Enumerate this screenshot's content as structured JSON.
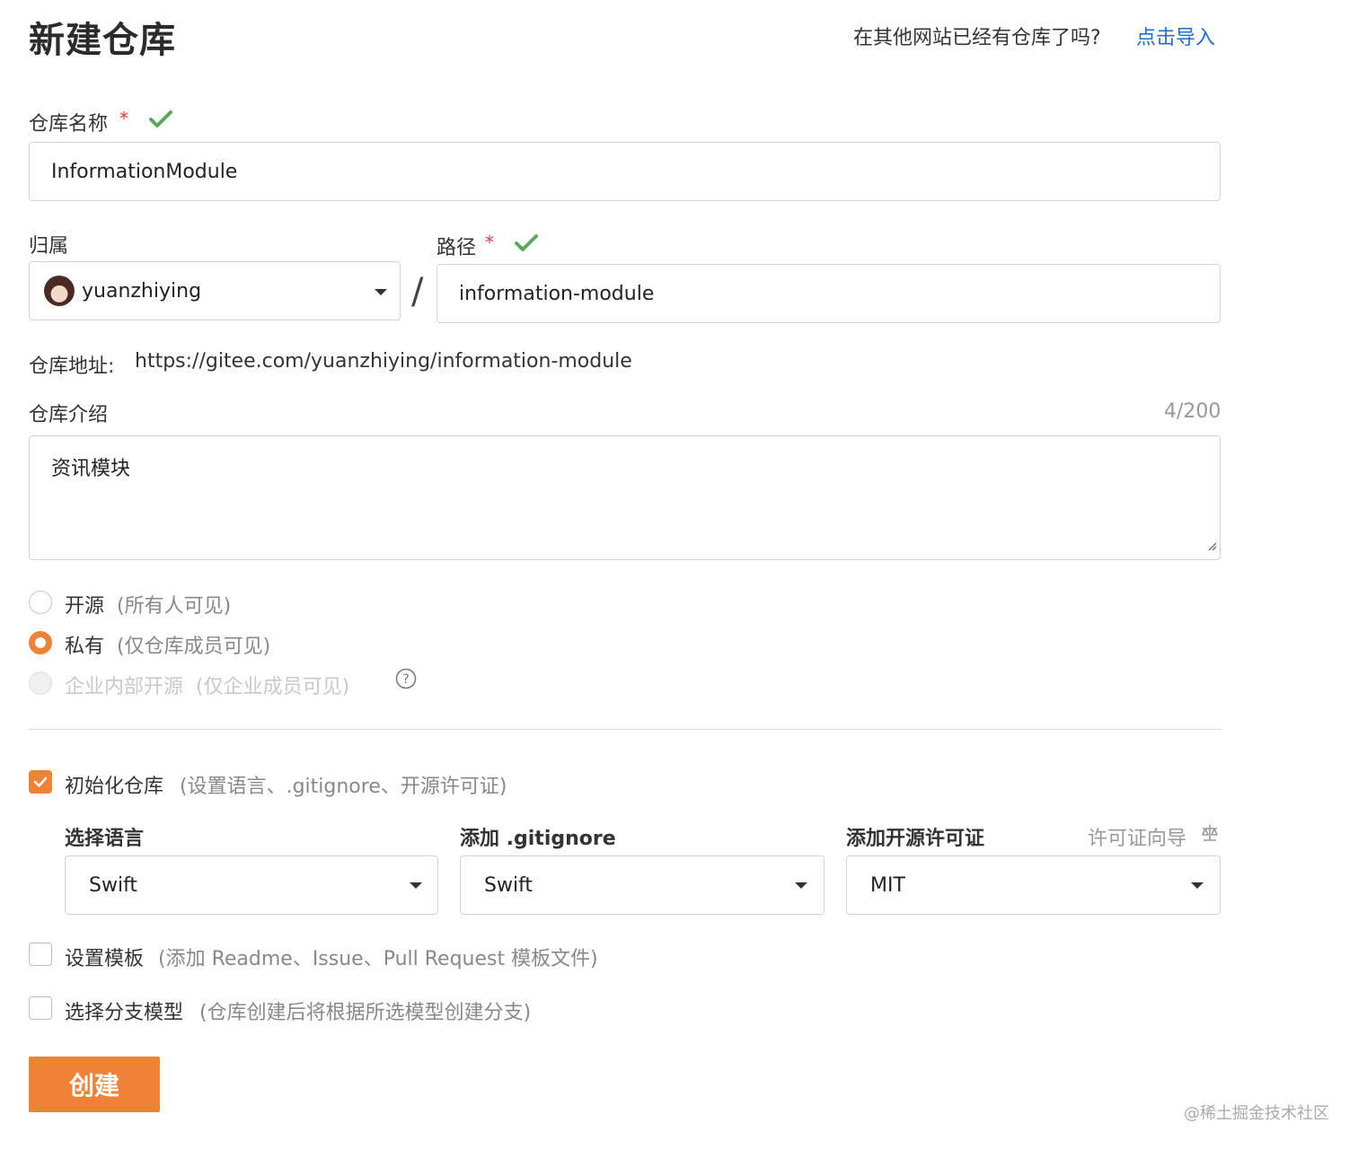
{
  "header": {
    "title": "新建仓库",
    "import_prompt": "在其他网站已经有仓库了吗?",
    "import_link": "点击导入"
  },
  "repo_name": {
    "label": "仓库名称",
    "required_mark": "*",
    "value": "InformationModule"
  },
  "owner": {
    "label": "归属",
    "value": "yuanzhiying"
  },
  "separator": "/",
  "path": {
    "label": "路径",
    "required_mark": "*",
    "value": "information-module"
  },
  "repo_address": {
    "label": "仓库地址:",
    "url": "https://gitee.com/yuanzhiying/information-module"
  },
  "description": {
    "label": "仓库介绍",
    "counter": "4/200",
    "value": "资讯模块"
  },
  "visibility": {
    "options": [
      {
        "label": "开源",
        "hint": "(所有人可见)",
        "state": "unchecked"
      },
      {
        "label": "私有",
        "hint": "(仅仓库成员可见)",
        "state": "checked"
      },
      {
        "label": "企业内部开源",
        "hint": "(仅企业成员可见)",
        "state": "disabled"
      }
    ],
    "help_icon": "question-circle-icon"
  },
  "init_repo": {
    "label": "初始化仓库",
    "hint": "(设置语言、.gitignore、开源许可证)",
    "checked": true
  },
  "language": {
    "label": "选择语言",
    "value": "Swift"
  },
  "gitignore": {
    "label": "添加 .gitignore",
    "value": "Swift"
  },
  "license": {
    "label": "添加开源许可证",
    "guide": "许可证向导",
    "guide_icon": "balance-scale-icon",
    "value": "MIT"
  },
  "template": {
    "label": "设置模板",
    "hint": "(添加 Readme、Issue、Pull Request 模板文件)",
    "checked": false
  },
  "branch_model": {
    "label": "选择分支模型",
    "hint": "(仓库创建后将根据所选模型创建分支)",
    "checked": false
  },
  "create_button": "创建",
  "watermark": "@稀土掘金技术社区",
  "colors": {
    "accent": "#f08235",
    "link": "#1f6fc5",
    "success": "#5ba85c",
    "required": "#e4393c"
  }
}
